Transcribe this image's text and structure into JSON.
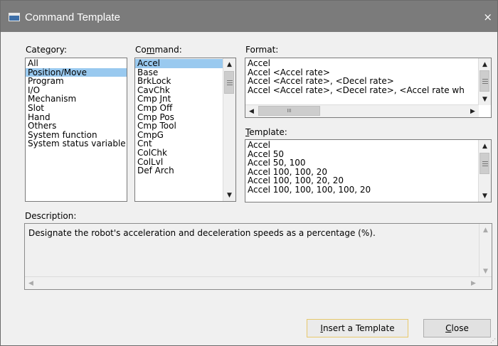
{
  "window": {
    "title": "Command Template",
    "close_glyph": "×"
  },
  "category": {
    "label_pre": "Cate",
    "label_key": "g",
    "label_post": "ory:",
    "items": [
      "All",
      "Position/Move",
      "Program",
      "I/O",
      "Mechanism",
      "Slot",
      "Hand",
      "Others",
      "System function",
      "System status variable"
    ],
    "selected": "Position/Move"
  },
  "command": {
    "label_pre": "Co",
    "label_key": "m",
    "label_post": "mand:",
    "items": [
      "Accel",
      "Base",
      "BrkLock",
      "CavChk",
      "Cmp Jnt",
      "Cmp Off",
      "Cmp Pos",
      "Cmp Tool",
      "CmpG",
      "Cnt",
      "ColChk",
      "ColLvl",
      "Def Arch"
    ],
    "selected": "Accel"
  },
  "format": {
    "label": "Format:",
    "items": [
      "Accel",
      "Accel  <Accel rate>",
      "Accel  <Accel rate>, <Decel rate>",
      "Accel  <Accel rate>, <Decel rate>, <Accel rate wh"
    ]
  },
  "template": {
    "label_key": "T",
    "label_post": "emplate:",
    "items": [
      "Accel",
      "Accel 50",
      "Accel 50, 100",
      "Accel 100, 100, 20",
      "Accel 100, 100, 20, 20",
      "Accel 100, 100, 100, 100, 20"
    ]
  },
  "description": {
    "label": "Description:",
    "text": "Designate the robot's acceleration and deceleration speeds as a percentage (%)."
  },
  "buttons": {
    "insert_key": "I",
    "insert_post": "nsert a Template",
    "close_key": "C",
    "close_post": "lose"
  },
  "glyphs": {
    "up": "▲",
    "down": "▼",
    "left": "◀",
    "right": "▶",
    "thumb_h": "III"
  }
}
